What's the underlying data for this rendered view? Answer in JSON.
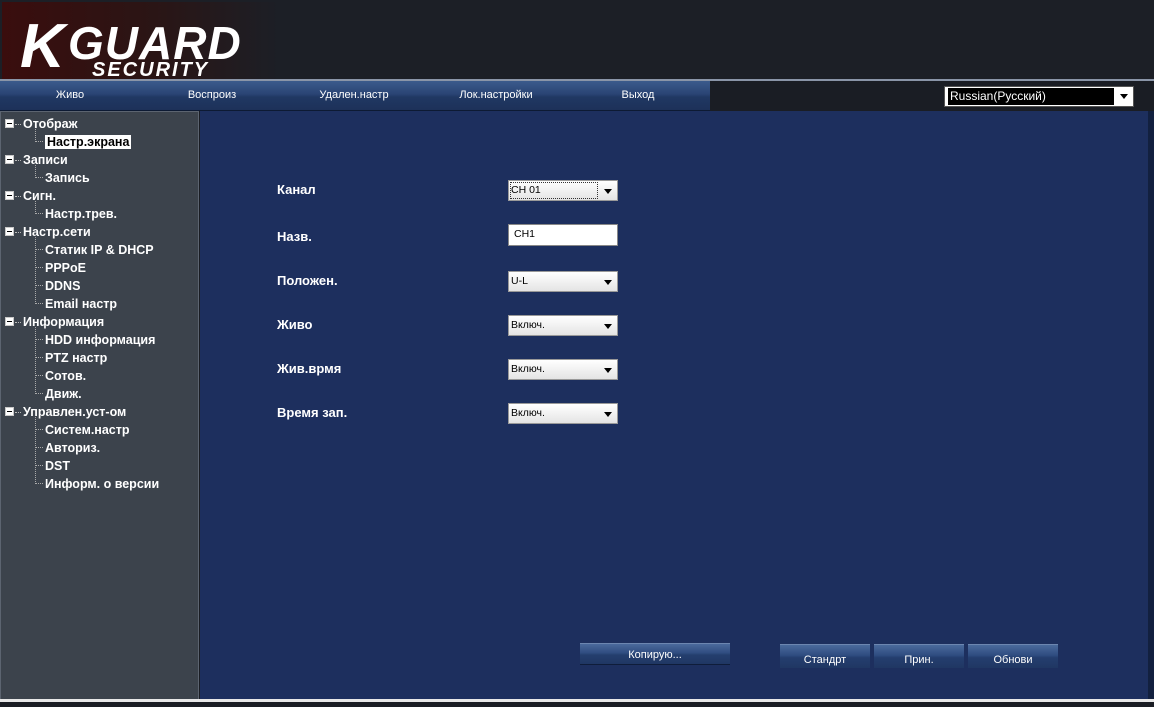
{
  "logo": {
    "k": "K",
    "guard": "GUARD",
    "security": "SECURITY"
  },
  "nav": {
    "live": "Живо",
    "playback": "Воспроиз",
    "remote": "Удален.настр",
    "local": "Лок.настройки",
    "exit": "Выход"
  },
  "language": {
    "selected": "Russian(Русский)"
  },
  "sidebar": {
    "display": {
      "label": "Отображ",
      "items": [
        "Настр.экрана"
      ]
    },
    "records": {
      "label": "Записи",
      "items": [
        "Запись"
      ]
    },
    "alarm": {
      "label": "Сигн.",
      "items": [
        "Настр.трев."
      ]
    },
    "network": {
      "label": "Настр.сети",
      "items": [
        "Статик IP & DHCP",
        "PPPoE",
        "DDNS",
        "Email настр"
      ]
    },
    "info": {
      "label": "Информация",
      "items": [
        "HDD информация",
        "PTZ настр",
        "Сотов.",
        "Движ."
      ]
    },
    "manage": {
      "label": "Управлен.уст-ом",
      "items": [
        "Систем.настр",
        "Авториз.",
        "DST",
        "Информ. о версии"
      ]
    }
  },
  "form": {
    "channel": {
      "label": "Канал",
      "value": "CH 01"
    },
    "name": {
      "label": "Назв.",
      "value": "CH1"
    },
    "position": {
      "label": "Положен.",
      "value": "U-L"
    },
    "live": {
      "label": "Живо",
      "value": "Включ."
    },
    "live_time": {
      "label": "Жив.врмя",
      "value": "Включ."
    },
    "rec_time": {
      "label": "Время зап.",
      "value": "Включ."
    }
  },
  "buttons": {
    "copy": "Копирую...",
    "default": "Стандрт",
    "apply": "Прин.",
    "refresh": "Обнови"
  }
}
